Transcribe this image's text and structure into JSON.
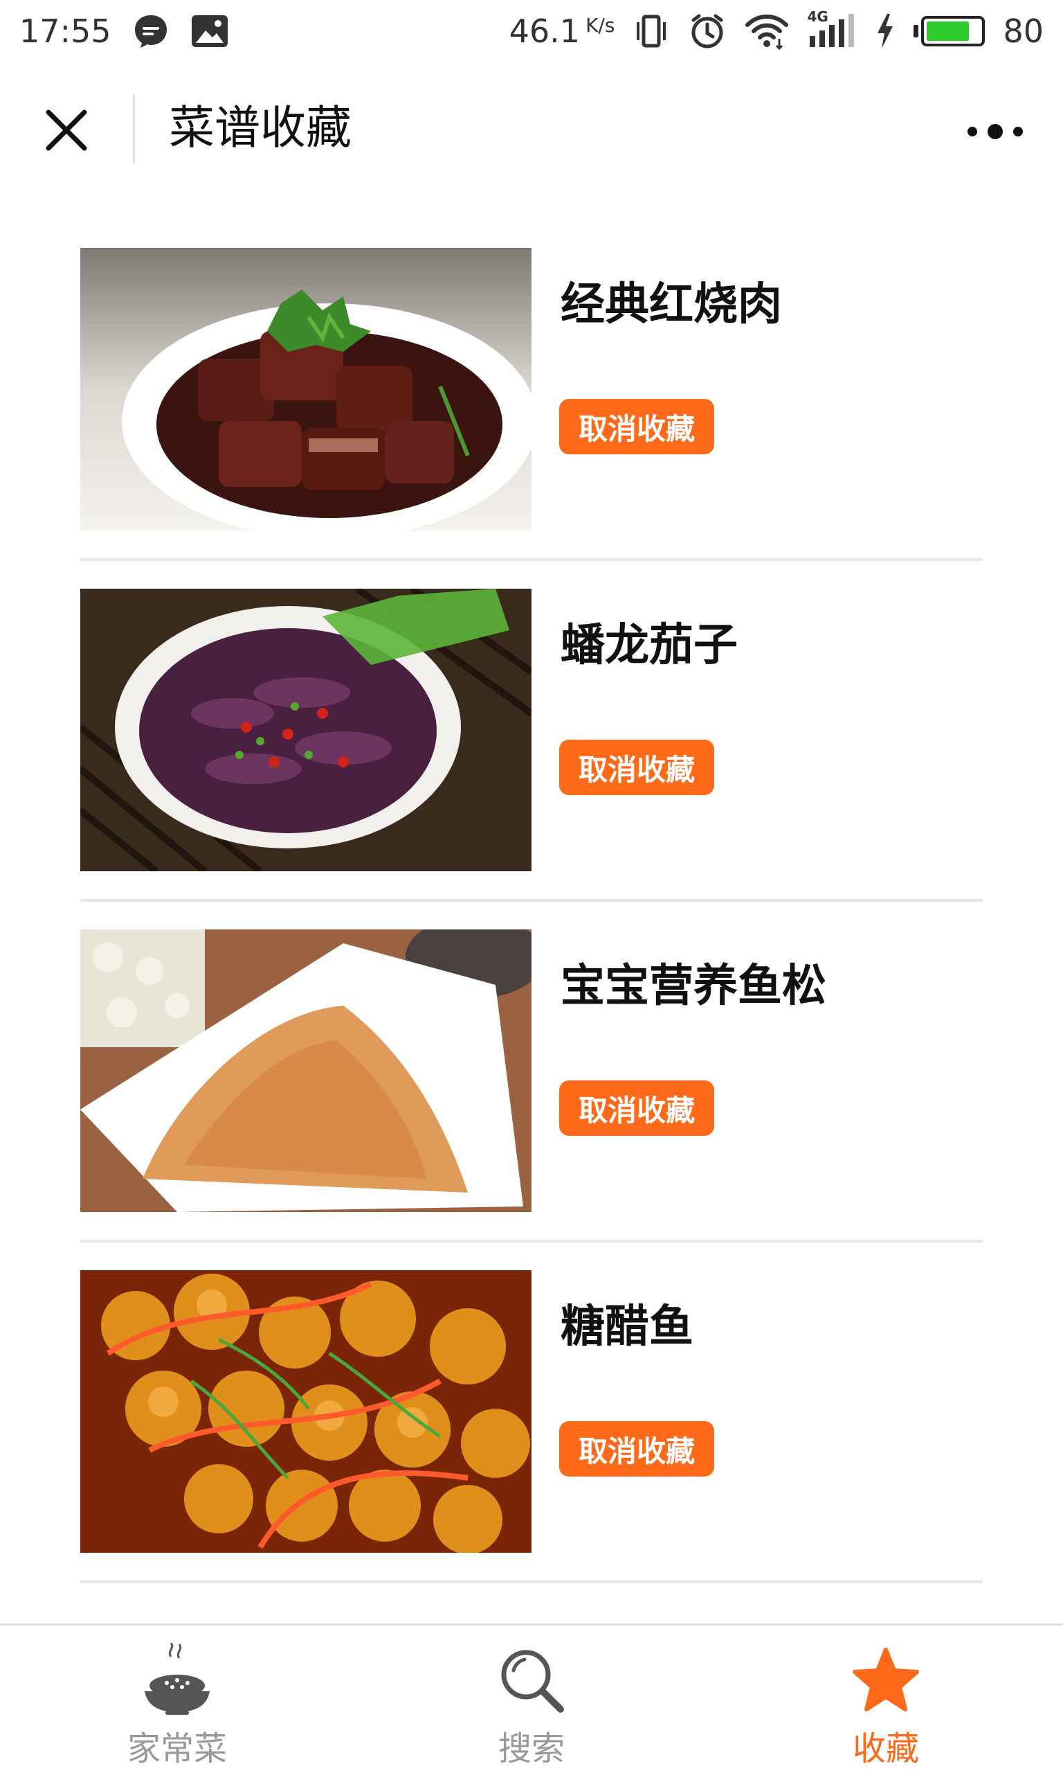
{
  "status_bar": {
    "time": "17:55",
    "net_speed": "46.1",
    "net_unit": "K/s",
    "signal_label": "4G",
    "battery_level": "80",
    "battery_fraction": 0.8
  },
  "header": {
    "title": "菜谱收藏",
    "close_icon": "close-icon",
    "more_icon": "more-icon"
  },
  "recipes": [
    {
      "name": "经典红烧肉",
      "action_label": "取消收藏"
    },
    {
      "name": "蟠龙茄子",
      "action_label": "取消收藏"
    },
    {
      "name": "宝宝营养鱼松",
      "action_label": "取消收藏"
    },
    {
      "name": "糖醋鱼",
      "action_label": "取消收藏"
    }
  ],
  "tab_bar": {
    "tabs": [
      {
        "label": "家常菜",
        "icon": "rice-bowl-icon",
        "active": false
      },
      {
        "label": "搜索",
        "icon": "search-icon",
        "active": false
      },
      {
        "label": "收藏",
        "icon": "star-icon",
        "active": true
      }
    ]
  },
  "colors": {
    "accent": "#ff6a1a",
    "inactive_tab": "#999999",
    "divider": "#e6e6e6"
  }
}
